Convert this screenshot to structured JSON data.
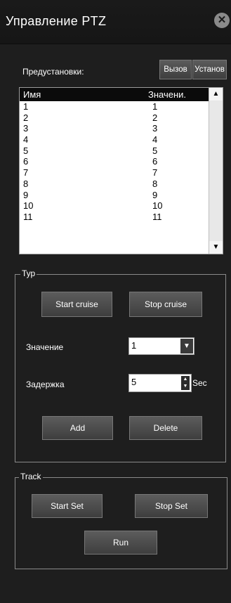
{
  "window": {
    "title": "Управление PTZ",
    "close": "✕"
  },
  "presets": {
    "label": "Предустановки:",
    "call_button": "Вызов",
    "set_button": "Установ",
    "columns": [
      "Имя",
      "Значени."
    ],
    "rows": [
      [
        "1",
        "1"
      ],
      [
        "2",
        "2"
      ],
      [
        "3",
        "3"
      ],
      [
        "4",
        "4"
      ],
      [
        "5",
        "5"
      ],
      [
        "6",
        "6"
      ],
      [
        "7",
        "7"
      ],
      [
        "8",
        "8"
      ],
      [
        "9",
        "9"
      ],
      [
        "10",
        "10"
      ],
      [
        "11",
        "11"
      ]
    ],
    "scroll_up": "▲",
    "scroll_down": "▼"
  },
  "tour": {
    "legend": "Тур",
    "start_cruise": "Start cruise",
    "stop_cruise": "Stop cruise",
    "value_label": "Значение",
    "value_selected": "1",
    "delay_label": "Задержка",
    "delay_value": "5",
    "delay_unit": "Sec",
    "add": "Add",
    "delete": "Delete"
  },
  "track": {
    "legend": "Track",
    "start_set": "Start Set",
    "stop_set": "Stop Set",
    "run": "Run"
  }
}
